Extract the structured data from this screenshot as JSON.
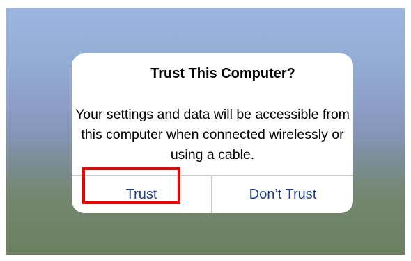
{
  "dialog": {
    "title": "Trust This Computer?",
    "message": "Your settings and data will be accessible from this computer when connected wirelessly or using a cable.",
    "trust_label": "Trust",
    "dont_trust_label": "Don’t Trust"
  },
  "colors": {
    "button_text": "#1c3f8c",
    "highlight": "#ee0000"
  }
}
